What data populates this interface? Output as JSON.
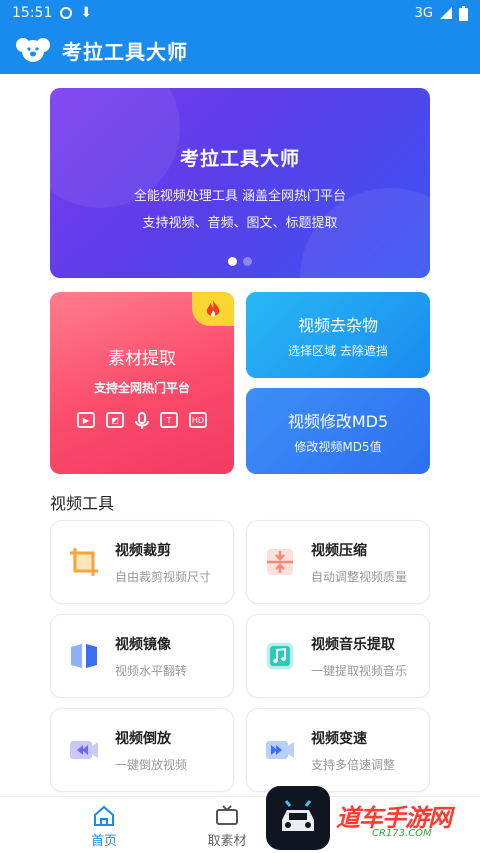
{
  "status": {
    "time": "15:51",
    "network": "3G"
  },
  "appbar": {
    "title": "考拉工具大师"
  },
  "banner": {
    "title": "考拉工具大师",
    "line1": "全能视频处理工具 涵盖全网热门平台",
    "line2": "支持视频、音频、图文、标题提取"
  },
  "features": {
    "material": {
      "title": "素材提取",
      "subtitle": "支持全网热门平台",
      "icons": [
        "video-icon",
        "image-icon",
        "mic-icon",
        "text-icon",
        "hd-icon"
      ],
      "hd_text": "HD",
      "t_text": "T"
    },
    "remove": {
      "title": "视频去杂物",
      "subtitle": "选择区域 去除遮挡"
    },
    "md5": {
      "title": "视频修改MD5",
      "subtitle": "修改视频MD5值"
    }
  },
  "section": {
    "title": "视频工具"
  },
  "tools": [
    {
      "title": "视频裁剪",
      "subtitle": "自由裁剪视频尺寸",
      "icon": "crop-icon"
    },
    {
      "title": "视频压缩",
      "subtitle": "自动调整视频质量",
      "icon": "compress-icon"
    },
    {
      "title": "视频镜像",
      "subtitle": "视频水平翻转",
      "icon": "mirror-icon"
    },
    {
      "title": "视频音乐提取",
      "subtitle": "一键提取视频音乐",
      "icon": "music-icon"
    },
    {
      "title": "视频倒放",
      "subtitle": "一键倒放视频",
      "icon": "rewind-icon"
    },
    {
      "title": "视频变速",
      "subtitle": "支持多倍速调整",
      "icon": "speed-icon"
    }
  ],
  "nav": {
    "home": "首页",
    "material": "取素材"
  },
  "watermark": {
    "text": "道车手游网",
    "sub": "CR173.COM"
  },
  "colors": {
    "primary": "#1a8bee",
    "banner": "#5a3ee8",
    "material": "#fb4b6a",
    "badge": "#f9d532"
  }
}
